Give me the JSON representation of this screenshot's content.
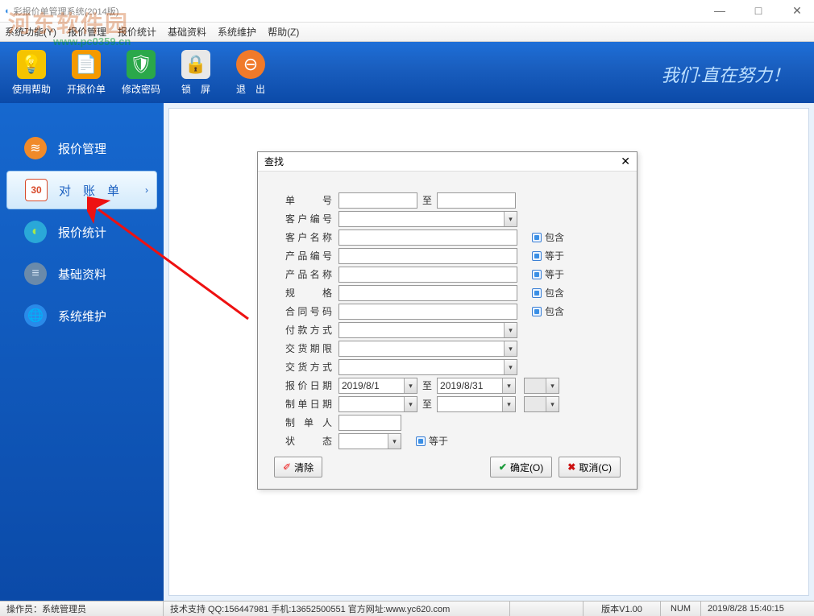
{
  "title": "彩报价单管理系统(2014版)",
  "watermark": {
    "big": "河东软件园",
    "url": "www.pc0359.cn"
  },
  "menu": [
    "系统功能(Y)",
    "报价管理",
    "报价统计",
    "基础资料",
    "系统维护",
    "帮助(Z)"
  ],
  "toolbar": {
    "items": [
      {
        "label": "使用帮助",
        "icon": "💡",
        "bg": "#f5c400"
      },
      {
        "label": "开报价单",
        "icon": "📄",
        "bg": "#f59a00"
      },
      {
        "label": "修改密码",
        "icon": "🛡",
        "bg": "#2aa84a"
      },
      {
        "label": "锁　屏",
        "icon": "🔒",
        "bg": "#d8d8d8"
      },
      {
        "label": "退　出",
        "icon": "⊖",
        "bg": "#f07a2a"
      }
    ],
    "slogan": "我们·直在努力！"
  },
  "sidebar": [
    {
      "label": "报价管理",
      "icon": "≋",
      "bg": "#f08a2a"
    },
    {
      "label": "对　账　单",
      "icon": "30",
      "bg": "#fff",
      "active": true
    },
    {
      "label": "报价统计",
      "icon": "◐",
      "bg": "#2aa8d8"
    },
    {
      "label": "基础资料",
      "icon": "≡",
      "bg": "#6a8aaa"
    },
    {
      "label": "系统维护",
      "icon": "🌐",
      "bg": "#2a8ae8"
    }
  ],
  "dialog": {
    "title": "查找",
    "labels": {
      "danhao": "单　　号",
      "kehubh": "客户编号",
      "kehumc": "客户名称",
      "cpbh": "产品编号",
      "cpmc": "产品名称",
      "guige": "规　　格",
      "hthm": "合同号码",
      "fkfs": "付款方式",
      "jhqx": "交货期限",
      "jhfs": "交货方式",
      "bjrq": "报价日期",
      "zdrq": "制单日期",
      "zdr": "制 单 人",
      "zt": "状　　态",
      "to": "至",
      "baohan": "包含",
      "dengyu": "等于"
    },
    "values": {
      "bjrq_from": "2019/8/1",
      "bjrq_to": "2019/8/31"
    },
    "buttons": {
      "clear": "清除",
      "ok": "确定(O)",
      "cancel": "取消(C)"
    }
  },
  "status": {
    "operator_label": "操作员：",
    "operator": "系统管理员",
    "support": "技术支持 QQ:156447981 手机:13652500551 官方网址:www.yc620.com",
    "version": "版本V1.00",
    "num": "NUM",
    "datetime": "2019/8/28 15:40:15"
  }
}
